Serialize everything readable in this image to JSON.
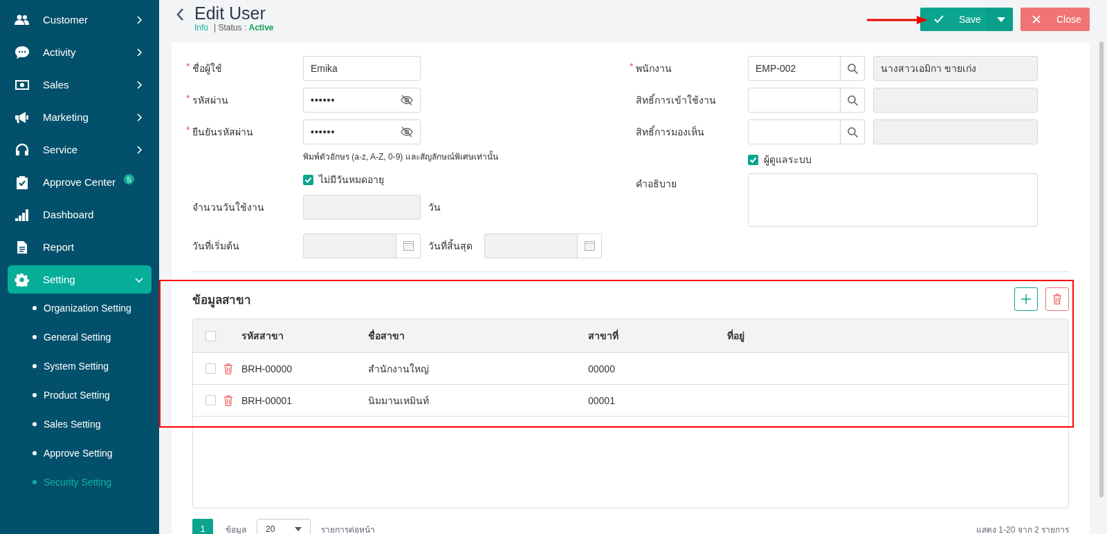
{
  "sidebar": {
    "items": [
      {
        "label": "Customer",
        "kind": "group",
        "expanded": false,
        "selected": false
      },
      {
        "label": "Activity",
        "kind": "group",
        "expanded": false,
        "selected": false
      },
      {
        "label": "Sales",
        "kind": "group",
        "expanded": false,
        "selected": false
      },
      {
        "label": "Marketing",
        "kind": "group",
        "expanded": false,
        "selected": false
      },
      {
        "label": "Service",
        "kind": "group",
        "expanded": false,
        "selected": false
      },
      {
        "label": "Approve Center",
        "kind": "link",
        "selected": false,
        "badge": "5"
      },
      {
        "label": "Dashboard",
        "kind": "link",
        "selected": false
      },
      {
        "label": "Report",
        "kind": "link",
        "selected": false
      },
      {
        "label": "Setting",
        "kind": "group",
        "expanded": true,
        "selected": true,
        "children": [
          {
            "label": "Organization Setting",
            "selected": false
          },
          {
            "label": "General Setting",
            "selected": false
          },
          {
            "label": "System Setting",
            "selected": false
          },
          {
            "label": "Product Setting",
            "selected": false
          },
          {
            "label": "Sales Setting",
            "selected": false
          },
          {
            "label": "Approve Setting",
            "selected": false
          },
          {
            "label": "Security Setting",
            "selected": true
          }
        ]
      }
    ]
  },
  "header": {
    "title": "Edit User",
    "info_link": "Info",
    "status_label": "| Status :",
    "status": "Active",
    "buttons": [
      {
        "kind": "save",
        "label": "Save"
      },
      {
        "kind": "close",
        "label": "Close"
      }
    ]
  },
  "form": {
    "left": {
      "fields": [
        {
          "label": "ชื่อผู้ใช้",
          "required_mark": "*",
          "kind": "text",
          "value": "Emika"
        },
        {
          "label": "รหัสผ่าน",
          "required_mark": "*",
          "kind": "password",
          "value": "••••••"
        },
        {
          "label": "ยืนยันรหัสผ่าน",
          "required_mark": "*",
          "kind": "password",
          "value": "••••••"
        }
      ],
      "hint": "พิมพ์ตัวอักษร (a-z, A-Z, 0-9) และสัญลักษณ์พิเศษเท่านั้น",
      "no_expiry": {
        "label": "ไม่มีวันหมดอายุ",
        "checked": true
      },
      "days": {
        "label": "จำนวนวันใช้งาน",
        "unit": "วัน"
      },
      "start_date": {
        "label": "วันที่เริ่มต้น"
      },
      "end_date": {
        "label": "วันที่สิ้นสุด"
      }
    },
    "right": {
      "lookups": [
        {
          "label": "พนักงาน",
          "required_mark": "*",
          "code": "EMP-002",
          "name": "นางสาวเอมิกา ขายเก่ง"
        },
        {
          "label": "สิทธิ์การเข้าใช้งาน"
        },
        {
          "label": "สิทธิ์การมองเห็น"
        }
      ],
      "admin": {
        "label": "ผู้ดูแลระบบ",
        "checked": true
      },
      "description": {
        "label": "คำอธิบาย"
      }
    }
  },
  "branches": {
    "title": "ข้อมูลสาขา",
    "columns": [
      "รหัสสาขา",
      "ชื่อสาขา",
      "สาขาที่",
      "ที่อยู่"
    ],
    "all_checked": false,
    "rows": [
      {
        "checked": false,
        "code": "BRH-00000",
        "name": "สำนักงานใหญ่",
        "number": "00000"
      },
      {
        "checked": false,
        "code": "BRH-00001",
        "name": "นิมมานเหมินท์",
        "number": "00001"
      }
    ],
    "pagination": {
      "pages": [
        {
          "label": "1",
          "selected": true
        }
      ],
      "data_label": "ข้อมูล",
      "page_size": "20",
      "per_page_label": "รายการต่อหน้า",
      "summary": "แสดง 1-20 จาก 2 รายการ"
    }
  }
}
